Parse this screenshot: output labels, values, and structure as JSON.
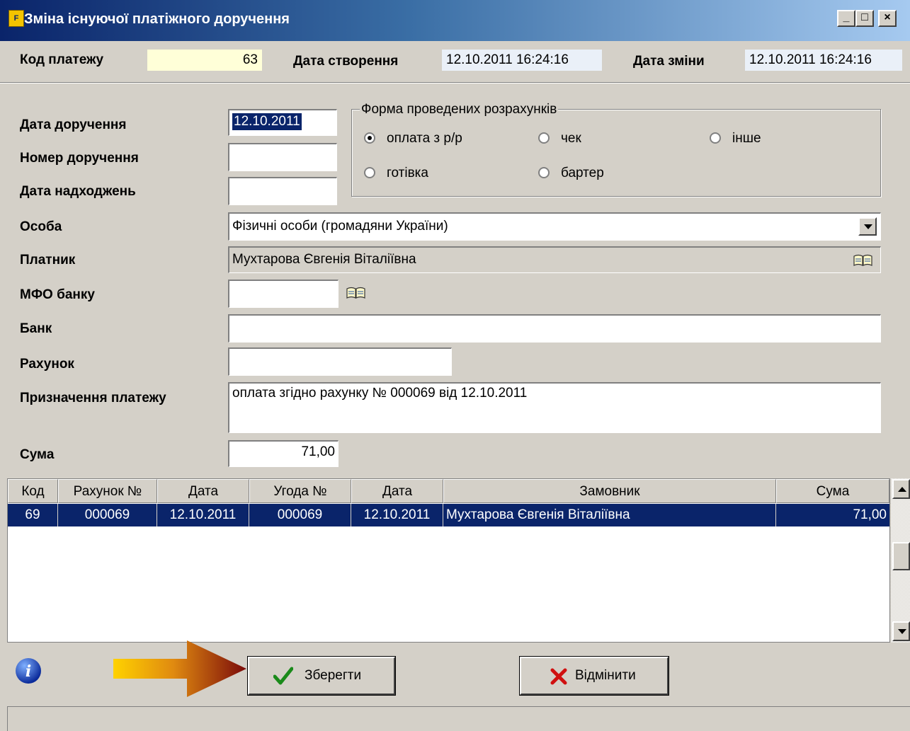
{
  "window": {
    "title": "Зміна існуючої платіжного доручення",
    "app_icon_text": "F"
  },
  "header": {
    "payment_code_label": "Код платежу",
    "payment_code_value": "63",
    "created_label": "Дата створення",
    "created_value": "12.10.2011 16:24:16",
    "modified_label": "Дата зміни",
    "modified_value": "12.10.2011 16:24:16"
  },
  "form": {
    "order_date_label": "Дата доручення",
    "order_date_value": "12.10.2011",
    "order_number_label": "Номер доручення",
    "order_number_value": "",
    "receipt_date_label": "Дата надходжень",
    "receipt_date_value": "",
    "person_label": "Особа",
    "person_value": "Фізичні особи (громадяни України)",
    "payer_label": "Платник",
    "payer_value": "Мухтарова Євгенія Віталіївна",
    "mfo_label": "МФО банку",
    "mfo_value": "",
    "bank_label": "Банк",
    "bank_value": "",
    "account_label": "Рахунок",
    "account_value": "",
    "purpose_label": "Призначення платежу",
    "purpose_value": "оплата згідно рахунку № 000069 від 12.10.2011",
    "sum_label": "Сума",
    "sum_value": "71,00"
  },
  "payment_form": {
    "title": "Форма проведених розрахунків",
    "options": [
      {
        "label": "оплата з р/р",
        "selected": true
      },
      {
        "label": "чек",
        "selected": false
      },
      {
        "label": "інше",
        "selected": false
      },
      {
        "label": "готівка",
        "selected": false
      },
      {
        "label": "бартер",
        "selected": false
      }
    ]
  },
  "grid": {
    "columns": [
      "Код",
      "Рахунок №",
      "Дата",
      "Угода №",
      "Дата",
      "Замовник",
      "Сума"
    ],
    "rows": [
      [
        "69",
        "000069",
        "12.10.2011",
        "000069",
        "12.10.2011",
        "Мухтарова Євгенія Віталіївна",
        "71,00"
      ]
    ]
  },
  "buttons": {
    "save_label": "Зберегти",
    "cancel_label": "Відмінити"
  },
  "colors": {
    "selection": "#0a246a",
    "arrow_start": "#ffd200",
    "arrow_end": "#7a0a0a",
    "save_icon": "#1a8a1a",
    "cancel_icon": "#d01010",
    "info_icon": "#1040c0"
  }
}
